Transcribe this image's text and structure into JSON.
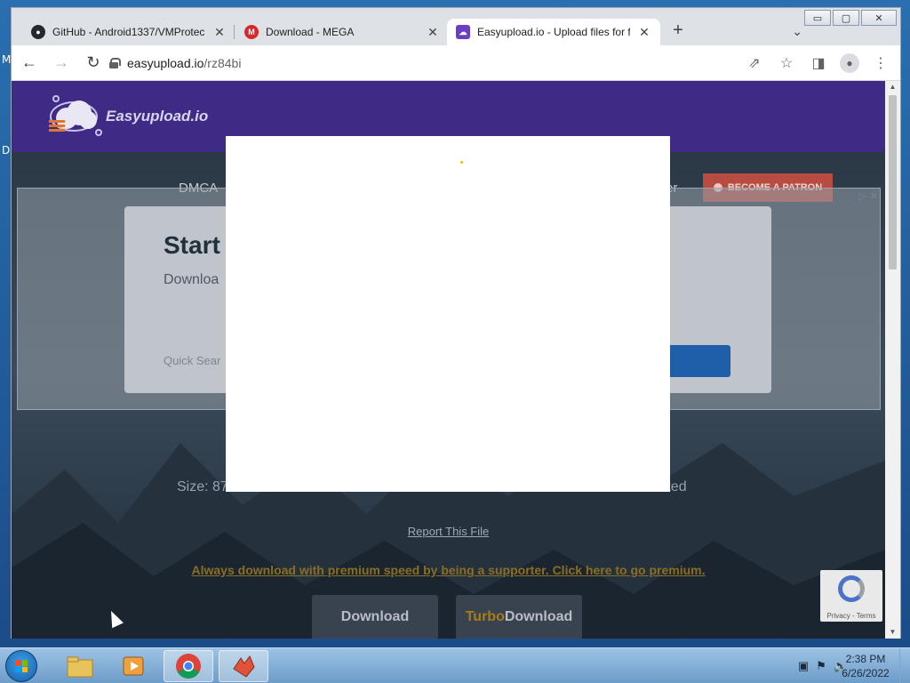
{
  "desktop": {
    "left_labels": [
      "M",
      "D"
    ]
  },
  "window": {
    "minimize": "▭",
    "maximize": "▢",
    "close": "✕"
  },
  "tabs": [
    {
      "title": "GitHub - Android1337/VMProtec",
      "favicon": "github-icon"
    },
    {
      "title": "Download - MEGA",
      "favicon": "mega-icon"
    },
    {
      "title": "Easyupload.io - Upload files for f",
      "favicon": "easyupload-icon",
      "active": true
    }
  ],
  "tab_close": "✕",
  "new_tab": "+",
  "tab_menu": "⌄",
  "toolbar": {
    "back": "←",
    "forward": "→",
    "reload": "↻",
    "url_host": "easyupload.io",
    "url_path": "/rz84bi",
    "share": "⇗",
    "bookmark": "☆",
    "sidepanel": "◨",
    "profile": "●",
    "menu": "⋮"
  },
  "site": {
    "logo_text": "Easyupload.io",
    "nav": [
      "DMCA",
      "er"
    ],
    "patron_label": "BECOME A PATRON",
    "ad": {
      "title": "Start",
      "subtitle": "Downloa",
      "search_hint": "Quick Sear",
      "choices": [
        "▷",
        "✕"
      ]
    },
    "file_info_left": "Size: 87",
    "file_info_right": "tected",
    "report": "Report This File",
    "premium": "Always download with premium speed by being a supporter. Click here to go premium.",
    "download": "Download",
    "turbo_prefix": "Turbo",
    "turbo_suffix": " Download",
    "recaptcha_text": "Privacy - Terms"
  },
  "taskbar": {
    "time": "2:38 PM",
    "date": "6/26/2022",
    "tray_icons": [
      "network-icon",
      "flag-icon",
      "speaker-icon"
    ]
  },
  "colors": {
    "header_purple": "#3f2a86",
    "patron_red": "#b94c41",
    "premium_gold": "#8a6e22"
  }
}
